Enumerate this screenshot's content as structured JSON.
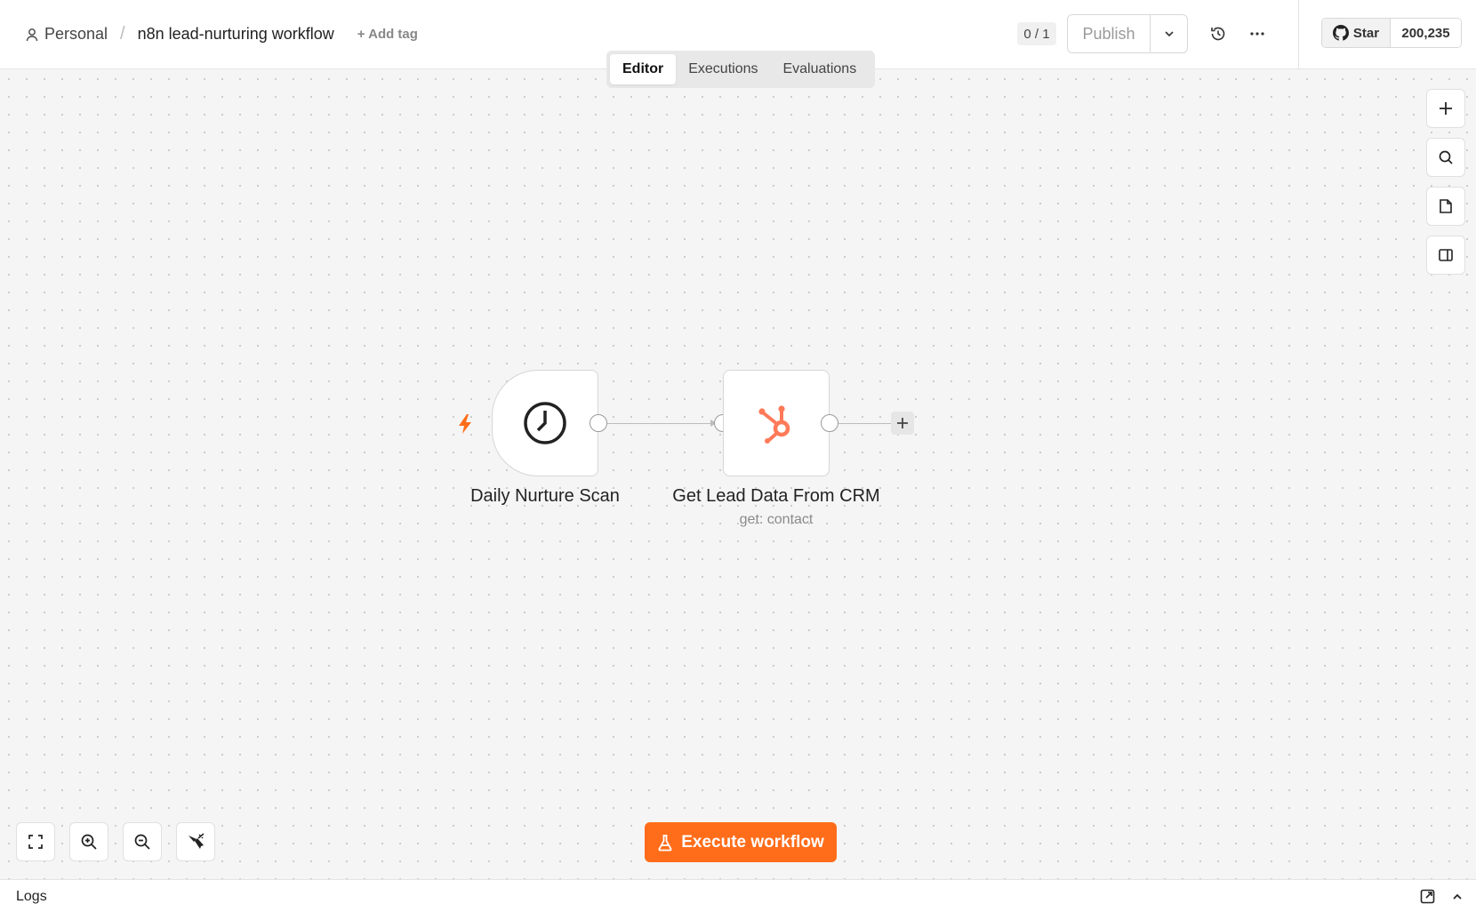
{
  "breadcrumb": {
    "project": "Personal",
    "separator": "/",
    "workflow_name": "n8n lead-nurturing workflow",
    "add_tag": "+ Add tag"
  },
  "header": {
    "counter": "0 / 1",
    "publish_label": "Publish",
    "github_star_label": "Star",
    "github_star_count": "200,235"
  },
  "tabs": [
    {
      "label": "Editor",
      "active": true
    },
    {
      "label": "Executions",
      "active": false
    },
    {
      "label": "Evaluations",
      "active": false
    }
  ],
  "nodes": [
    {
      "label": "Daily Nurture Scan",
      "subtitle": "",
      "icon": "clock-icon",
      "trigger": true
    },
    {
      "label": "Get Lead Data From CRM",
      "subtitle": "get: contact",
      "icon": "hubspot-icon",
      "trigger": false
    }
  ],
  "canvas_controls": {
    "execute_label": "Execute workflow"
  },
  "logs": {
    "title": "Logs"
  },
  "colors": {
    "accent": "#ff6d1a",
    "hubspot": "#ff7a59"
  }
}
